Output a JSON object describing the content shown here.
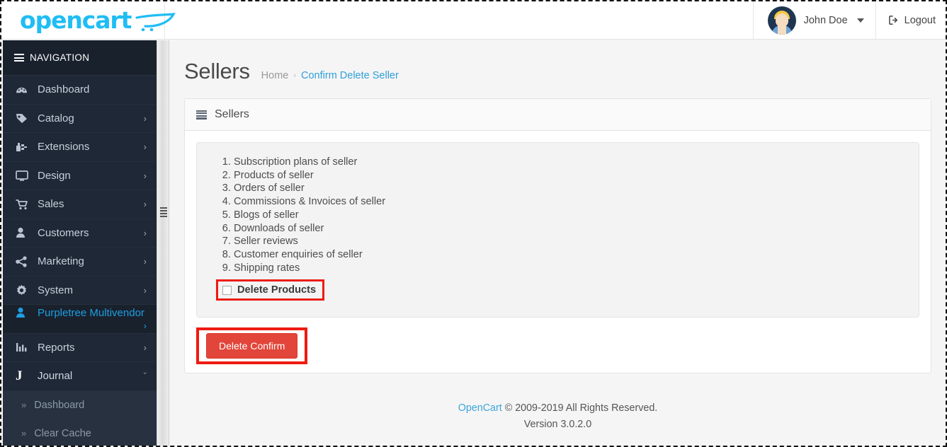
{
  "header": {
    "logo_text": "opencart",
    "logo_icon": "shopping-cart-swoosh-icon",
    "user_name": "John Doe",
    "user_caret_icon": "caret-down-icon",
    "avatar_icon": "user-avatar",
    "logout_label": "Logout",
    "logout_icon": "logout-icon"
  },
  "sidebar": {
    "nav_title": "NAVIGATION",
    "nav_icon": "hamburger-icon",
    "items": [
      {
        "label": "Dashboard",
        "icon": "dashboard-gauge-icon",
        "arrow": "",
        "active": false
      },
      {
        "label": "Catalog",
        "icon": "tag-icon",
        "arrow": "›",
        "active": false
      },
      {
        "label": "Extensions",
        "icon": "puzzle-plug-icon",
        "arrow": "›",
        "active": false
      },
      {
        "label": "Design",
        "icon": "monitor-icon",
        "arrow": "›",
        "active": false
      },
      {
        "label": "Sales",
        "icon": "shopping-cart-icon",
        "arrow": "›",
        "active": false
      },
      {
        "label": "Customers",
        "icon": "user-icon",
        "arrow": "›",
        "active": false
      },
      {
        "label": "Marketing",
        "icon": "share-nodes-icon",
        "arrow": "›",
        "active": false
      },
      {
        "label": "System",
        "icon": "gear-icon",
        "arrow": "›",
        "active": false
      },
      {
        "label": "Purpletree Multivendor",
        "icon": "user-icon",
        "arrow": "›",
        "active": true
      },
      {
        "label": "Reports",
        "icon": "bar-chart-icon",
        "arrow": "›",
        "active": false
      },
      {
        "label": "Journal",
        "icon": "journal-j-icon",
        "arrow": "ˇ",
        "active": false
      }
    ],
    "sub_items": [
      {
        "label": "Dashboard",
        "icon": "double-chevron-right-icon"
      },
      {
        "label": "Clear Cache",
        "icon": "double-chevron-right-icon"
      }
    ]
  },
  "page": {
    "title": "Sellers",
    "breadcrumb": {
      "home": "Home",
      "separator": "›",
      "current": "Confirm Delete Seller"
    }
  },
  "panel": {
    "heading": "Sellers",
    "heading_icon": "list-icon",
    "delete_items": [
      "Subscription plans of seller",
      "Products of seller",
      "Orders of seller",
      "Commissions & Invoices of seller",
      "Blogs of seller",
      "Downloads of seller",
      "Seller reviews",
      "Customer enquiries of seller",
      "Shipping rates"
    ],
    "checkbox": {
      "label": "Delete Products",
      "checked": false
    },
    "confirm_button": {
      "label": "Delete Confirm",
      "color": "#e2453a"
    }
  },
  "footer": {
    "brand": "OpenCart",
    "copyright": "© 2009-2019 All Rights Reserved.",
    "version": "Version 3.0.2.0"
  },
  "colors": {
    "brand_blue": "#20bdf4",
    "sidebar_bg": "#1f2836",
    "active_blue": "#1e9fe0",
    "danger_red": "#e2453a",
    "annotation_red": "#ee1b11"
  }
}
